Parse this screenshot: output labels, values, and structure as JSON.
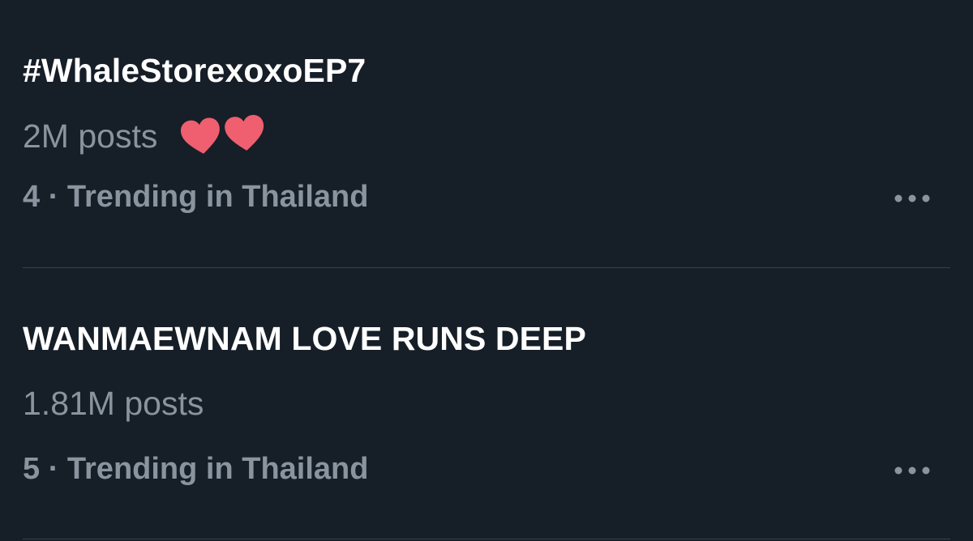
{
  "trends": [
    {
      "title": "#WhaleStorexoxoEP7",
      "posts": "2M posts",
      "meta": "4 · Trending in Thailand",
      "emoji": "heart-icon"
    },
    {
      "title": "WANMAEWNAM LOVE RUNS DEEP",
      "posts": "1.81M posts",
      "meta": "5 · Trending in Thailand"
    }
  ],
  "colors": {
    "background": "#161e28",
    "title": "#ffffff",
    "secondary": "#8a949e",
    "divider": "#38414b",
    "heart": "#ef5f6f"
  }
}
